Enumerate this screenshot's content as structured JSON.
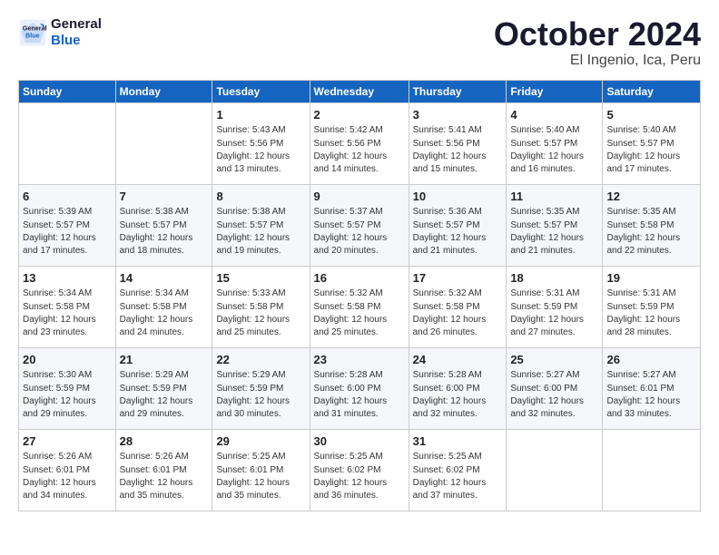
{
  "logo": {
    "line1": "General",
    "line2": "Blue"
  },
  "title": "October 2024",
  "location": "El Ingenio, Ica, Peru",
  "weekdays": [
    "Sunday",
    "Monday",
    "Tuesday",
    "Wednesday",
    "Thursday",
    "Friday",
    "Saturday"
  ],
  "weeks": [
    [
      {
        "day": "",
        "info": ""
      },
      {
        "day": "",
        "info": ""
      },
      {
        "day": "1",
        "info": "Sunrise: 5:43 AM\nSunset: 5:56 PM\nDaylight: 12 hours\nand 13 minutes."
      },
      {
        "day": "2",
        "info": "Sunrise: 5:42 AM\nSunset: 5:56 PM\nDaylight: 12 hours\nand 14 minutes."
      },
      {
        "day": "3",
        "info": "Sunrise: 5:41 AM\nSunset: 5:56 PM\nDaylight: 12 hours\nand 15 minutes."
      },
      {
        "day": "4",
        "info": "Sunrise: 5:40 AM\nSunset: 5:57 PM\nDaylight: 12 hours\nand 16 minutes."
      },
      {
        "day": "5",
        "info": "Sunrise: 5:40 AM\nSunset: 5:57 PM\nDaylight: 12 hours\nand 17 minutes."
      }
    ],
    [
      {
        "day": "6",
        "info": "Sunrise: 5:39 AM\nSunset: 5:57 PM\nDaylight: 12 hours\nand 17 minutes."
      },
      {
        "day": "7",
        "info": "Sunrise: 5:38 AM\nSunset: 5:57 PM\nDaylight: 12 hours\nand 18 minutes."
      },
      {
        "day": "8",
        "info": "Sunrise: 5:38 AM\nSunset: 5:57 PM\nDaylight: 12 hours\nand 19 minutes."
      },
      {
        "day": "9",
        "info": "Sunrise: 5:37 AM\nSunset: 5:57 PM\nDaylight: 12 hours\nand 20 minutes."
      },
      {
        "day": "10",
        "info": "Sunrise: 5:36 AM\nSunset: 5:57 PM\nDaylight: 12 hours\nand 21 minutes."
      },
      {
        "day": "11",
        "info": "Sunrise: 5:35 AM\nSunset: 5:57 PM\nDaylight: 12 hours\nand 21 minutes."
      },
      {
        "day": "12",
        "info": "Sunrise: 5:35 AM\nSunset: 5:58 PM\nDaylight: 12 hours\nand 22 minutes."
      }
    ],
    [
      {
        "day": "13",
        "info": "Sunrise: 5:34 AM\nSunset: 5:58 PM\nDaylight: 12 hours\nand 23 minutes."
      },
      {
        "day": "14",
        "info": "Sunrise: 5:34 AM\nSunset: 5:58 PM\nDaylight: 12 hours\nand 24 minutes."
      },
      {
        "day": "15",
        "info": "Sunrise: 5:33 AM\nSunset: 5:58 PM\nDaylight: 12 hours\nand 25 minutes."
      },
      {
        "day": "16",
        "info": "Sunrise: 5:32 AM\nSunset: 5:58 PM\nDaylight: 12 hours\nand 25 minutes."
      },
      {
        "day": "17",
        "info": "Sunrise: 5:32 AM\nSunset: 5:58 PM\nDaylight: 12 hours\nand 26 minutes."
      },
      {
        "day": "18",
        "info": "Sunrise: 5:31 AM\nSunset: 5:59 PM\nDaylight: 12 hours\nand 27 minutes."
      },
      {
        "day": "19",
        "info": "Sunrise: 5:31 AM\nSunset: 5:59 PM\nDaylight: 12 hours\nand 28 minutes."
      }
    ],
    [
      {
        "day": "20",
        "info": "Sunrise: 5:30 AM\nSunset: 5:59 PM\nDaylight: 12 hours\nand 29 minutes."
      },
      {
        "day": "21",
        "info": "Sunrise: 5:29 AM\nSunset: 5:59 PM\nDaylight: 12 hours\nand 29 minutes."
      },
      {
        "day": "22",
        "info": "Sunrise: 5:29 AM\nSunset: 5:59 PM\nDaylight: 12 hours\nand 30 minutes."
      },
      {
        "day": "23",
        "info": "Sunrise: 5:28 AM\nSunset: 6:00 PM\nDaylight: 12 hours\nand 31 minutes."
      },
      {
        "day": "24",
        "info": "Sunrise: 5:28 AM\nSunset: 6:00 PM\nDaylight: 12 hours\nand 32 minutes."
      },
      {
        "day": "25",
        "info": "Sunrise: 5:27 AM\nSunset: 6:00 PM\nDaylight: 12 hours\nand 32 minutes."
      },
      {
        "day": "26",
        "info": "Sunrise: 5:27 AM\nSunset: 6:01 PM\nDaylight: 12 hours\nand 33 minutes."
      }
    ],
    [
      {
        "day": "27",
        "info": "Sunrise: 5:26 AM\nSunset: 6:01 PM\nDaylight: 12 hours\nand 34 minutes."
      },
      {
        "day": "28",
        "info": "Sunrise: 5:26 AM\nSunset: 6:01 PM\nDaylight: 12 hours\nand 35 minutes."
      },
      {
        "day": "29",
        "info": "Sunrise: 5:25 AM\nSunset: 6:01 PM\nDaylight: 12 hours\nand 35 minutes."
      },
      {
        "day": "30",
        "info": "Sunrise: 5:25 AM\nSunset: 6:02 PM\nDaylight: 12 hours\nand 36 minutes."
      },
      {
        "day": "31",
        "info": "Sunrise: 5:25 AM\nSunset: 6:02 PM\nDaylight: 12 hours\nand 37 minutes."
      },
      {
        "day": "",
        "info": ""
      },
      {
        "day": "",
        "info": ""
      }
    ]
  ]
}
